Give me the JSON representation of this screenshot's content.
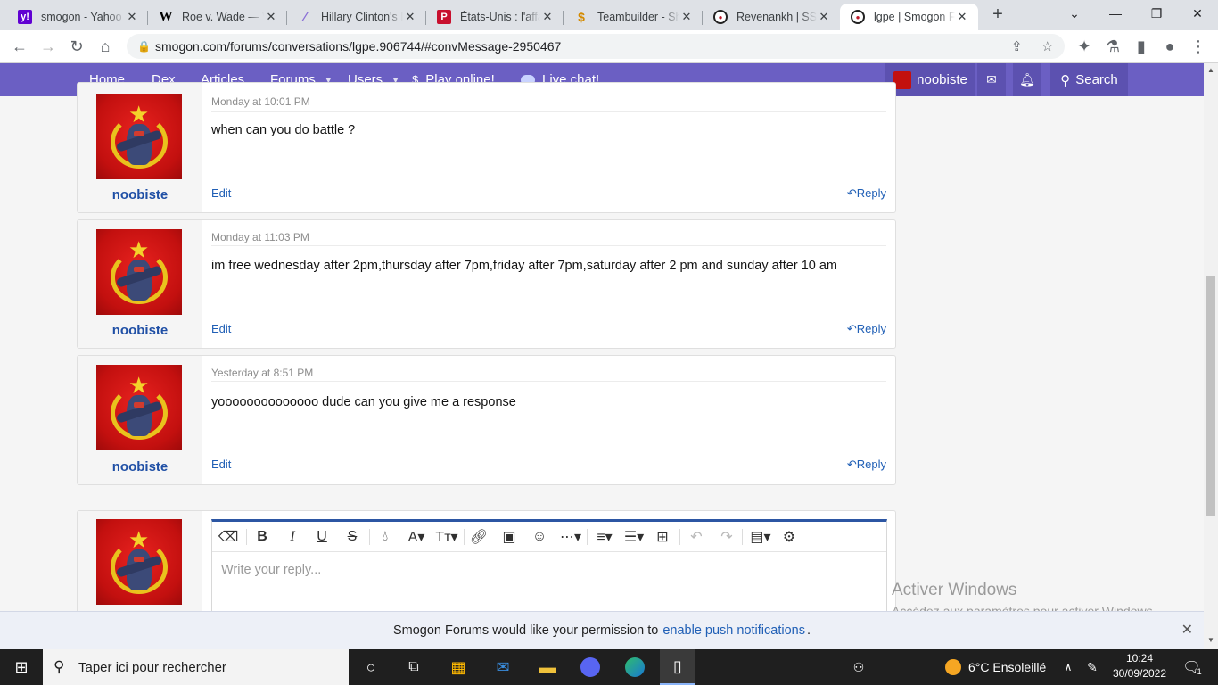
{
  "browser": {
    "tabs": [
      {
        "title": "smogon - Yahoo",
        "icon": "yahoo-icon"
      },
      {
        "title": "Roe v. Wade — W",
        "icon": "wikipedia-icon"
      },
      {
        "title": "Hillary Clinton's F",
        "icon": "feather-icon"
      },
      {
        "title": "États-Unis : l'affai",
        "icon": "parisien-icon"
      },
      {
        "title": "Teambuilder - Sh",
        "icon": "showdown-icon"
      },
      {
        "title": "Revenankh | SS |",
        "icon": "smogon-icon"
      },
      {
        "title": "lgpe | Smogon Fo",
        "icon": "smogon-icon"
      }
    ],
    "url": "smogon.com/forums/conversations/lgpe.906744/#convMessage-2950467"
  },
  "nav": {
    "home": "Home",
    "dex": "Dex",
    "articles": "Articles",
    "forums": "Forums",
    "users": "Users",
    "play": "Play online!",
    "chat": "Live chat!",
    "user": "noobiste",
    "search": "Search"
  },
  "messages": [
    {
      "date": "Monday at 10:01 PM",
      "author": "noobiste",
      "text": "when can you do battle ?",
      "edit": "Edit",
      "reply": "Reply"
    },
    {
      "date": "Monday at 11:03 PM",
      "author": "noobiste",
      "text": "im free wednesday after 2pm,thursday after 7pm,friday after 7pm,saturday after 2 pm and sunday after 10 am",
      "edit": "Edit",
      "reply": "Reply"
    },
    {
      "date": "Yesterday at 8:51 PM",
      "author": "noobiste",
      "text": "yoooooooooooooo dude can you give me a response",
      "edit": "Edit",
      "reply": "Reply"
    }
  ],
  "editor": {
    "placeholder": "Write your reply..."
  },
  "watermark": {
    "line1": "Activer Windows",
    "line2": "Accédez aux paramètres pour activer Windows."
  },
  "notice": {
    "before": "Smogon Forums would like your permission to",
    "link": "enable push notifications",
    "after": "."
  },
  "taskbar": {
    "search_placeholder": "Taper ici pour rechercher",
    "weather": "6°C  Ensoleillé",
    "time": "10:24",
    "date": "30/09/2022",
    "notifications": "1"
  },
  "colors": {
    "nav": "#6b5fc3",
    "link": "#2160b6",
    "username": "#1f4fa5",
    "avatar": "#c3100f"
  }
}
